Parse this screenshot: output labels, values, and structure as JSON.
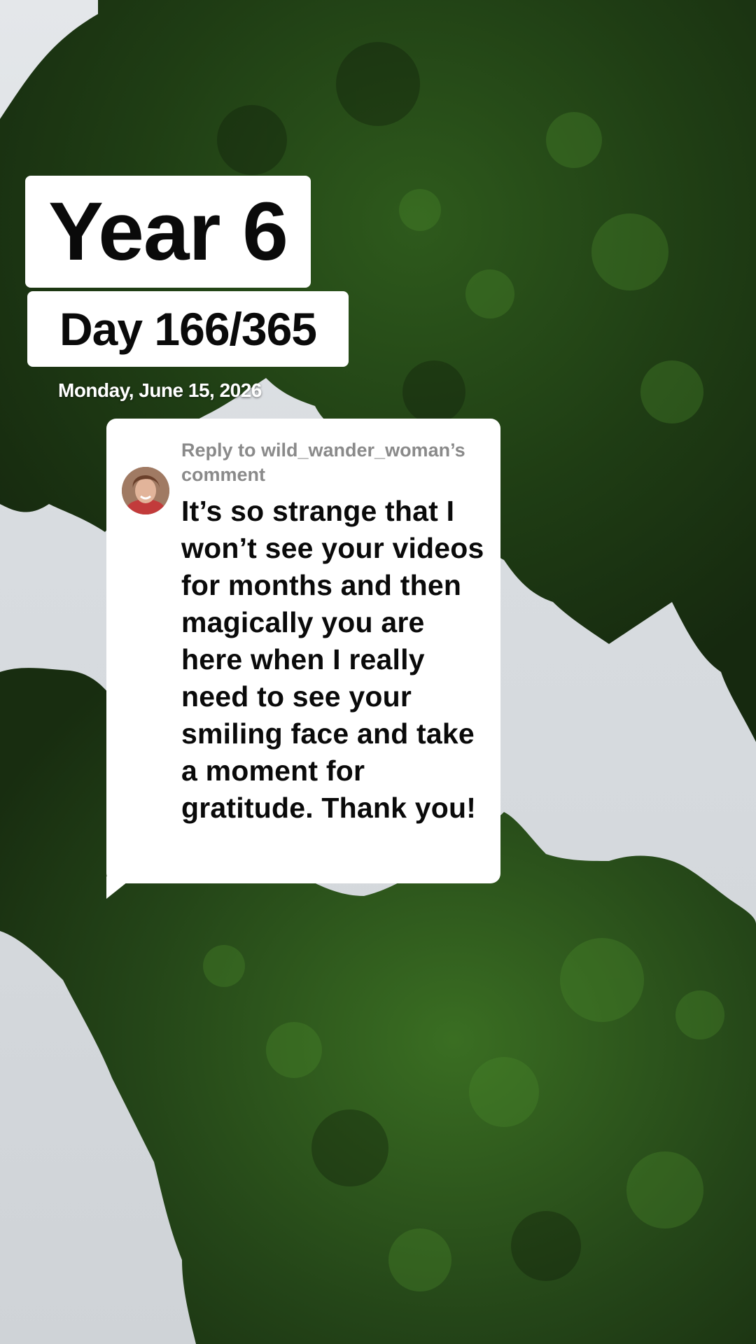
{
  "overlay": {
    "title": "Year 6",
    "day_counter": "Day 166/365",
    "date": "Monday, June 15, 2026"
  },
  "comment": {
    "reply_header": "Reply to wild_wander_woman’s comment",
    "text": "It’s so strange that I won’t see your videos for months and then magically you are here when I really need to see your smiling face and take a moment for gratitude. Thank you!",
    "avatar_icon": "user-avatar-photo"
  },
  "colors": {
    "card_background": "#ffffff",
    "reply_header": "#8a8a8a",
    "comment_text": "#0a0a0a",
    "foliage_dark": "#1f3a18",
    "foliage_mid": "#35621f",
    "sky": "#d8dce0"
  }
}
